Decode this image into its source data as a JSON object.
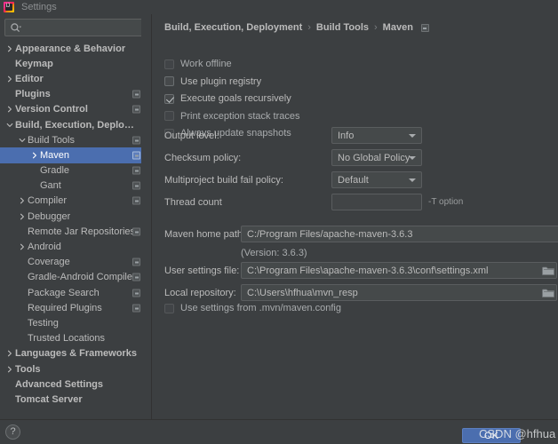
{
  "window": {
    "title": "Settings",
    "app_icon": "intellij-idea-icon"
  },
  "search": {
    "placeholder": "",
    "value": "",
    "icon": "search-icon"
  },
  "sidebar": {
    "items": [
      {
        "label": "Appearance & Behavior",
        "indent": 0,
        "chevron": "right",
        "bold": true,
        "badge": false,
        "selected": false
      },
      {
        "label": "Keymap",
        "indent": 0,
        "chevron": "none",
        "bold": true,
        "badge": false,
        "selected": false
      },
      {
        "label": "Editor",
        "indent": 0,
        "chevron": "right",
        "bold": true,
        "badge": false,
        "selected": false
      },
      {
        "label": "Plugins",
        "indent": 0,
        "chevron": "none",
        "bold": true,
        "badge": true,
        "selected": false
      },
      {
        "label": "Version Control",
        "indent": 0,
        "chevron": "right",
        "bold": true,
        "badge": true,
        "selected": false
      },
      {
        "label": "Build, Execution, Deployment",
        "indent": 0,
        "chevron": "down",
        "bold": true,
        "badge": false,
        "selected": false
      },
      {
        "label": "Build Tools",
        "indent": 1,
        "chevron": "down",
        "bold": false,
        "badge": true,
        "selected": false
      },
      {
        "label": "Maven",
        "indent": 2,
        "chevron": "right",
        "bold": false,
        "badge": true,
        "selected": true
      },
      {
        "label": "Gradle",
        "indent": 2,
        "chevron": "none",
        "bold": false,
        "badge": true,
        "selected": false
      },
      {
        "label": "Gant",
        "indent": 2,
        "chevron": "none",
        "bold": false,
        "badge": true,
        "selected": false
      },
      {
        "label": "Compiler",
        "indent": 1,
        "chevron": "right",
        "bold": false,
        "badge": true,
        "selected": false
      },
      {
        "label": "Debugger",
        "indent": 1,
        "chevron": "right",
        "bold": false,
        "badge": false,
        "selected": false
      },
      {
        "label": "Remote Jar Repositories",
        "indent": 1,
        "chevron": "none",
        "bold": false,
        "badge": true,
        "selected": false
      },
      {
        "label": "Android",
        "indent": 1,
        "chevron": "right",
        "bold": false,
        "badge": false,
        "selected": false
      },
      {
        "label": "Coverage",
        "indent": 1,
        "chevron": "none",
        "bold": false,
        "badge": true,
        "selected": false
      },
      {
        "label": "Gradle-Android Compiler",
        "indent": 1,
        "chevron": "none",
        "bold": false,
        "badge": true,
        "selected": false
      },
      {
        "label": "Package Search",
        "indent": 1,
        "chevron": "none",
        "bold": false,
        "badge": true,
        "selected": false
      },
      {
        "label": "Required Plugins",
        "indent": 1,
        "chevron": "none",
        "bold": false,
        "badge": true,
        "selected": false
      },
      {
        "label": "Testing",
        "indent": 1,
        "chevron": "none",
        "bold": false,
        "badge": false,
        "selected": false
      },
      {
        "label": "Trusted Locations",
        "indent": 1,
        "chevron": "none",
        "bold": false,
        "badge": false,
        "selected": false
      },
      {
        "label": "Languages & Frameworks",
        "indent": 0,
        "chevron": "right",
        "bold": true,
        "badge": false,
        "selected": false
      },
      {
        "label": "Tools",
        "indent": 0,
        "chevron": "right",
        "bold": true,
        "badge": false,
        "selected": false
      },
      {
        "label": "Advanced Settings",
        "indent": 0,
        "chevron": "none",
        "bold": true,
        "badge": false,
        "selected": false
      },
      {
        "label": "Tomcat Server",
        "indent": 0,
        "chevron": "none",
        "bold": true,
        "badge": false,
        "selected": false
      }
    ]
  },
  "main": {
    "breadcrumb": {
      "part1": "Build, Execution, Deployment",
      "sep1": "›",
      "part2": "Build Tools",
      "sep2": "›",
      "part3": "Maven",
      "badge": "project-scope-icon"
    },
    "checkboxes": [
      {
        "label": "Work offline",
        "checked": false,
        "dim": true
      },
      {
        "label": "Use plugin registry",
        "checked": false,
        "dim": false
      },
      {
        "label": "Execute goals recursively",
        "checked": true,
        "dim": false
      },
      {
        "label": "Print exception stack traces",
        "checked": false,
        "dim": true
      },
      {
        "label": "Always update snapshots",
        "checked": false,
        "dim": true
      }
    ],
    "fields": {
      "output_level": {
        "label": "Output level:",
        "value": "Info"
      },
      "checksum": {
        "label": "Checksum policy:",
        "value": "No Global Policy"
      },
      "fail_policy": {
        "label": "Multiproject build fail policy:",
        "value": "Default"
      },
      "thread_count": {
        "label": "Thread count",
        "value": "",
        "hint": "-T option"
      },
      "maven_home": {
        "label": "Maven home path:",
        "value": "C:/Program Files/apache-maven-3.6.3"
      },
      "version_note": "(Version: 3.6.3)",
      "user_settings": {
        "label": "User settings file:",
        "value": "C:\\Program Files\\apache-maven-3.6.3\\conf\\settings.xml",
        "browse_icon": "folder-icon"
      },
      "local_repo": {
        "label": "Local repository:",
        "value": "C:\\Users\\hfhua\\mvn_resp",
        "browse_icon": "folder-icon"
      }
    },
    "mvn_config_checkbox": {
      "label": "Use settings from .mvn/maven.config",
      "checked": false,
      "dim": true
    }
  },
  "bottom": {
    "help_label": "?",
    "ok_label": "OK",
    "watermark_prefix": "CSDN ",
    "watermark_user": "@hfhua"
  },
  "colors": {
    "bg": "#3c3f41",
    "field_bg": "#45494a",
    "selection": "#4b6eaf",
    "text": "#bbbbbb",
    "border": "#5a5d5f"
  }
}
